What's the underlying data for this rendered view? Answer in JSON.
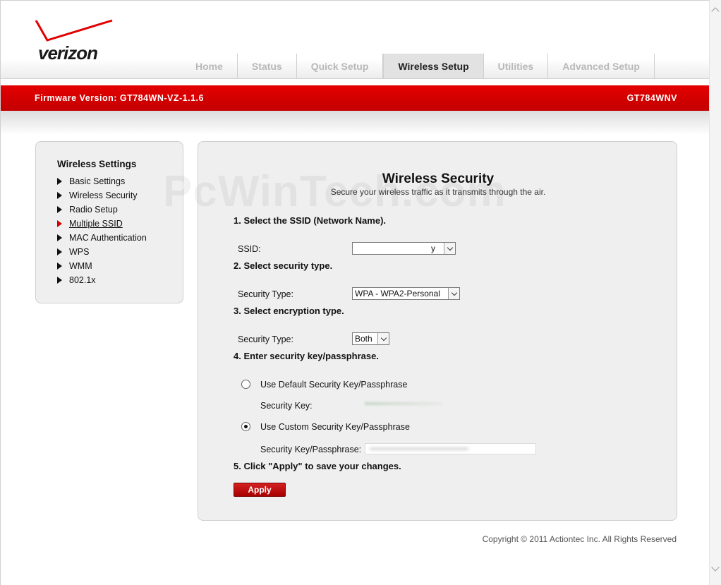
{
  "brand": {
    "logo_text": "verizon",
    "accent": "#d40000"
  },
  "nav": {
    "tabs": [
      {
        "label": "Home",
        "active": false
      },
      {
        "label": "Status",
        "active": false
      },
      {
        "label": "Quick Setup",
        "active": false
      },
      {
        "label": "Wireless Setup",
        "active": true
      },
      {
        "label": "Utilities",
        "active": false
      },
      {
        "label": "Advanced Setup",
        "active": false
      }
    ]
  },
  "banner": {
    "firmware": "Firmware Version: GT784WN-VZ-1.1.6",
    "model": "GT784WNV"
  },
  "sidebar": {
    "title": "Wireless Settings",
    "items": [
      {
        "label": "Basic Settings"
      },
      {
        "label": "Wireless Security"
      },
      {
        "label": "Radio Setup"
      },
      {
        "label": "Multiple SSID"
      },
      {
        "label": "MAC Authentication"
      },
      {
        "label": "WPS"
      },
      {
        "label": "WMM"
      },
      {
        "label": "802.1x"
      }
    ]
  },
  "watermark": "PcWinTech.com",
  "main": {
    "title": "Wireless Security",
    "subtitle": "Secure your wireless traffic as it transmits through the air.",
    "step1": "1. Select the SSID (Network Name).",
    "ssid_label": "SSID:",
    "ssid_value": "y",
    "step2": "2. Select security type.",
    "security_type_label": "Security Type:",
    "security_type_value": "WPA - WPA2-Personal",
    "step3": "3. Select encryption type.",
    "encryption_label": "Security Type:",
    "encryption_value": "Both",
    "step4": "4. Enter security key/passphrase.",
    "radio_default_label": "Use Default Security Key/Passphrase",
    "default_key_label": "Security Key:",
    "radio_custom_label": "Use Custom Security Key/Passphrase",
    "custom_key_label": "Security Key/Passphrase:",
    "step5": "5. Click \"Apply\" to save your changes.",
    "apply_label": "Apply"
  },
  "footer": {
    "copyright": "Copyright © 2011 Actiontec Inc. All Rights Reserved"
  }
}
